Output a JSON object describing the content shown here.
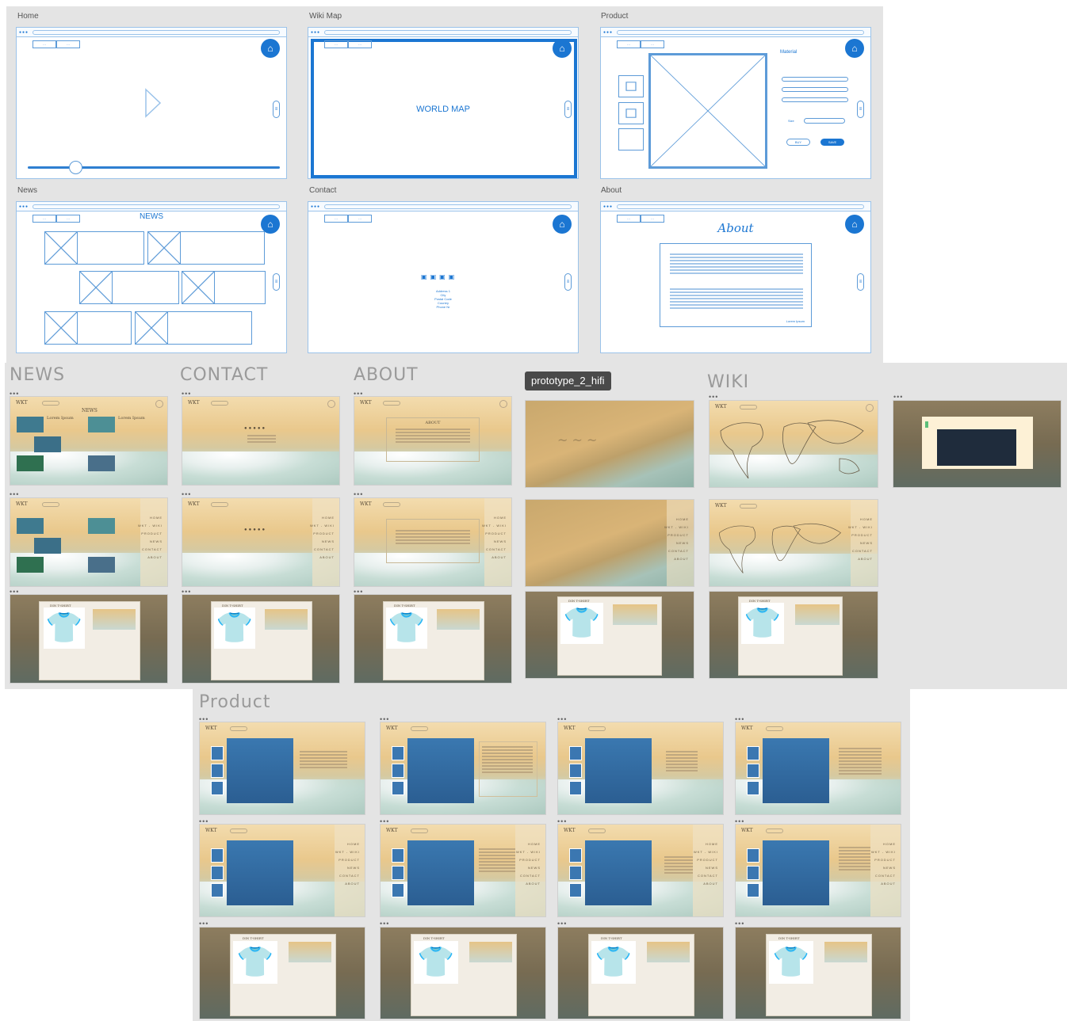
{
  "wireframes": {
    "home": {
      "label": "Home"
    },
    "wikimap": {
      "label": "Wiki Map",
      "center": "WORLD MAP"
    },
    "product": {
      "label": "Product",
      "material": "Material",
      "size": "Size",
      "buy": "BUY",
      "save": "SAVE"
    },
    "news": {
      "label": "News",
      "heading": "NEWS"
    },
    "contact": {
      "label": "Contact",
      "address": [
        "Address 1",
        "City",
        "Postal Code",
        "Country",
        "Phone Nr"
      ]
    },
    "about": {
      "label": "About",
      "heading": "About",
      "signature": "Lorem Ipsum"
    }
  },
  "sections": {
    "news": "NEWS",
    "contact": "CONTACT",
    "about": "ABOUT",
    "prototype": "prototype_2_hifi",
    "wiki": "WIKI",
    "product": "Product"
  },
  "hifi": {
    "news_title": "NEWS",
    "lorem": "Lorem Ipsum",
    "about_title": "ABOUT",
    "tshirt_title": "DIN T-SHIRT",
    "menu": [
      "HOME",
      "WKT - WIKI",
      "PRODUCT",
      "NEWS",
      "CONTACT",
      "ABOUT"
    ],
    "logo": "WKT"
  },
  "colors": {
    "wire_blue": "#1b76d2",
    "panel": "#e4e4e4",
    "prototype_tag": "#4a4a4a"
  }
}
